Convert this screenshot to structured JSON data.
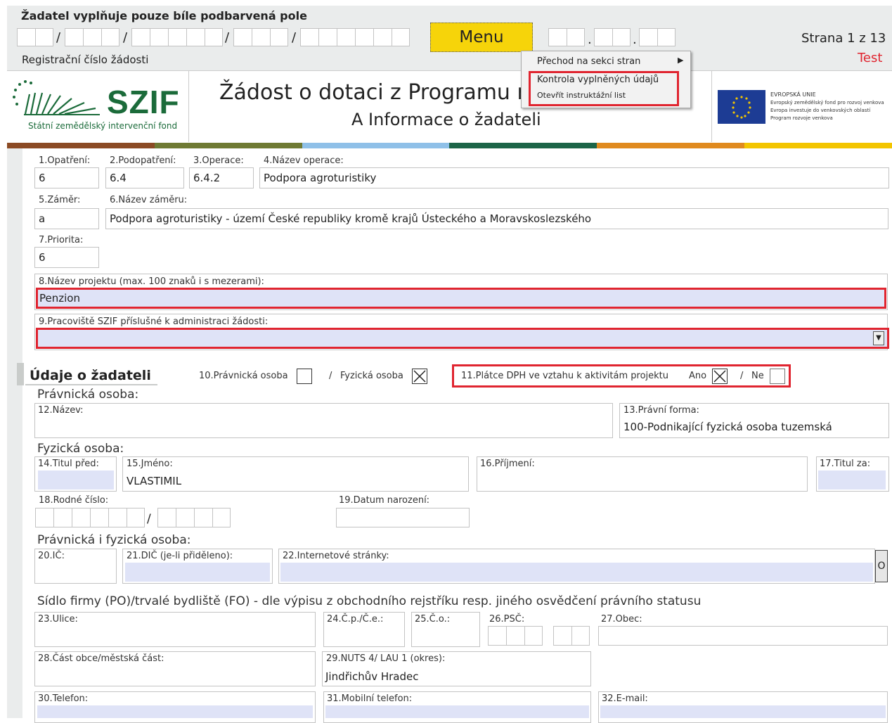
{
  "header": {
    "instruction": "Žadatel vyplňuje pouze bíle podbarvená pole",
    "reg_label": "Registrační číslo žádosti",
    "menu_label": "Menu",
    "page_info": "Strana 1 z 13",
    "mode": "Test"
  },
  "menu": {
    "items": [
      "Přechod na sekci stran",
      "Kontrola vyplněných údajů",
      "Otevřít instruktážní list"
    ]
  },
  "logo": {
    "name": "SZIF",
    "subtitle": "Státní zemědělský intervenční fond",
    "eu_line1": "EVROPSKÁ UNIE",
    "eu_line2": "Evropský zemědělský fond pro rozvoj venkova",
    "eu_line3": "Evropa investuje do venkovských oblastí",
    "eu_line4": "Program rozvoje venkova"
  },
  "title": {
    "main": "Žádost o dotaci z Programu r",
    "sub": "A Informace o žadateli"
  },
  "colors": {
    "stripe": [
      "#8b4a24",
      "#6f7a34",
      "#8fc0e8",
      "#1c6447",
      "#e08a1e",
      "#f3c500"
    ],
    "accent_red": "#e02530",
    "field_fill": "#dfe3f7",
    "menu_yellow": "#f6d40a"
  },
  "fields": {
    "f1": {
      "label": "1.Opatření:",
      "value": "6"
    },
    "f2": {
      "label": "2.Podopatření:",
      "value": "6.4"
    },
    "f3": {
      "label": "3.Operace:",
      "value": "6.4.2"
    },
    "f4": {
      "label": "4.Název operace:",
      "value": "Podpora agroturistiky"
    },
    "f5": {
      "label": "5.Záměr:",
      "value": "a"
    },
    "f6": {
      "label": "6.Název záměru:",
      "value": "Podpora agroturistiky - území České republiky kromě krajů Ústeckého a Moravskoslezského"
    },
    "f7": {
      "label": "7.Priorita:",
      "value": "6"
    },
    "f8": {
      "label": "8.Název projektu (max. 100 znaků i s mezerami):",
      "value": "Penzion"
    },
    "f9": {
      "label": "9.Pracoviště SZIF příslušné k administraci žádosti:",
      "value": ""
    }
  },
  "applicant": {
    "heading": "Údaje o žadateli",
    "f10_label": "10.Právnická osoba",
    "f10_fyz": "Fyzická osoba",
    "separator": "/",
    "f11_label": "11.Plátce DPH ve vztahu k aktivitám projektu",
    "ano": "Ano",
    "ne": "Ne",
    "po_heading": "Právnická osoba:",
    "f12_label": "12.Název:",
    "f13_label": "13.Právní forma:",
    "f13_value": "100-Podnikající fyzická osoba tuzemská",
    "fo_heading": "Fyzická osoba:",
    "f14_label": "14.Titul před:",
    "f15_label": "15.Jméno:",
    "f15_value": "VLASTIMIL",
    "f16_label": "16.Příjmení:",
    "f17_label": "17.Titul za:",
    "f18_label": "18.Rodné číslo:",
    "f19_label": "19.Datum narození:",
    "pofo_heading": "Právnická i fyzická osoba:",
    "f20_label": "20.IČ:",
    "f21_label": "21.DIČ (je-li přiděleno):",
    "f22_label": "22.Internetové stránky:",
    "f22_button": "O",
    "sidlo_heading": "Sídlo firmy (PO)/trvalé bydliště (FO) - dle výpisu z obchodního rejstříku resp. jiného osvědčení právního statusu",
    "f23_label": "23.Ulice:",
    "f24_label": "24.Č.p./Č.e.:",
    "f25_label": "25.Č.o.:",
    "f26_label": "26.PSČ:",
    "f27_label": "27.Obec:",
    "f28_label": "28.Část obce/městská část:",
    "f29_label": "29.NUTS 4/ LAU 1 (okres):",
    "f29_value": "Jindřichův Hradec",
    "f30_label": "30.Telefon:",
    "f31_label": "31.Mobilní telefon:",
    "f32_label": "32.E-mail:"
  }
}
